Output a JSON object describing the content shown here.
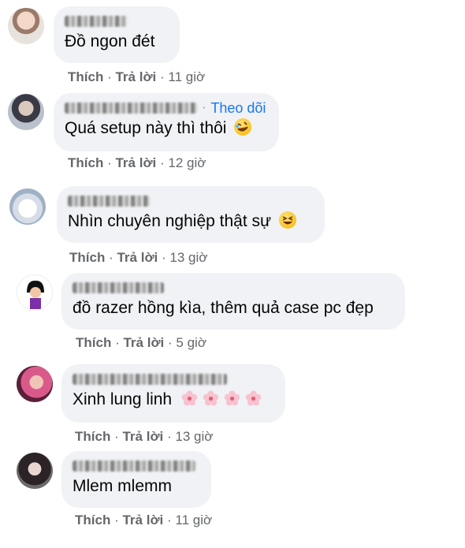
{
  "actions": {
    "like": "Thích",
    "reply": "Trả lời"
  },
  "comments": [
    {
      "text": "Đồ ngon đét",
      "time": "11 giờ"
    },
    {
      "text": "Quá setup này thì thôi",
      "time": "12 giờ",
      "follow": "Theo dõi",
      "emoji": "rolling-laughing-emoji"
    },
    {
      "text": "Nhìn chuyên nghiệp thật sự",
      "time": "13 giờ",
      "emoji": "grinning-squinting-emoji"
    },
    {
      "text": "đồ razer hồng kìa, thêm quả case pc đẹp",
      "time": "5 giờ"
    },
    {
      "text": "Xinh lung linh",
      "time": "13 giờ",
      "emoji": "cherry-blossom-emoji"
    },
    {
      "text": "Mlem mlemm",
      "time": "11 giờ"
    }
  ]
}
